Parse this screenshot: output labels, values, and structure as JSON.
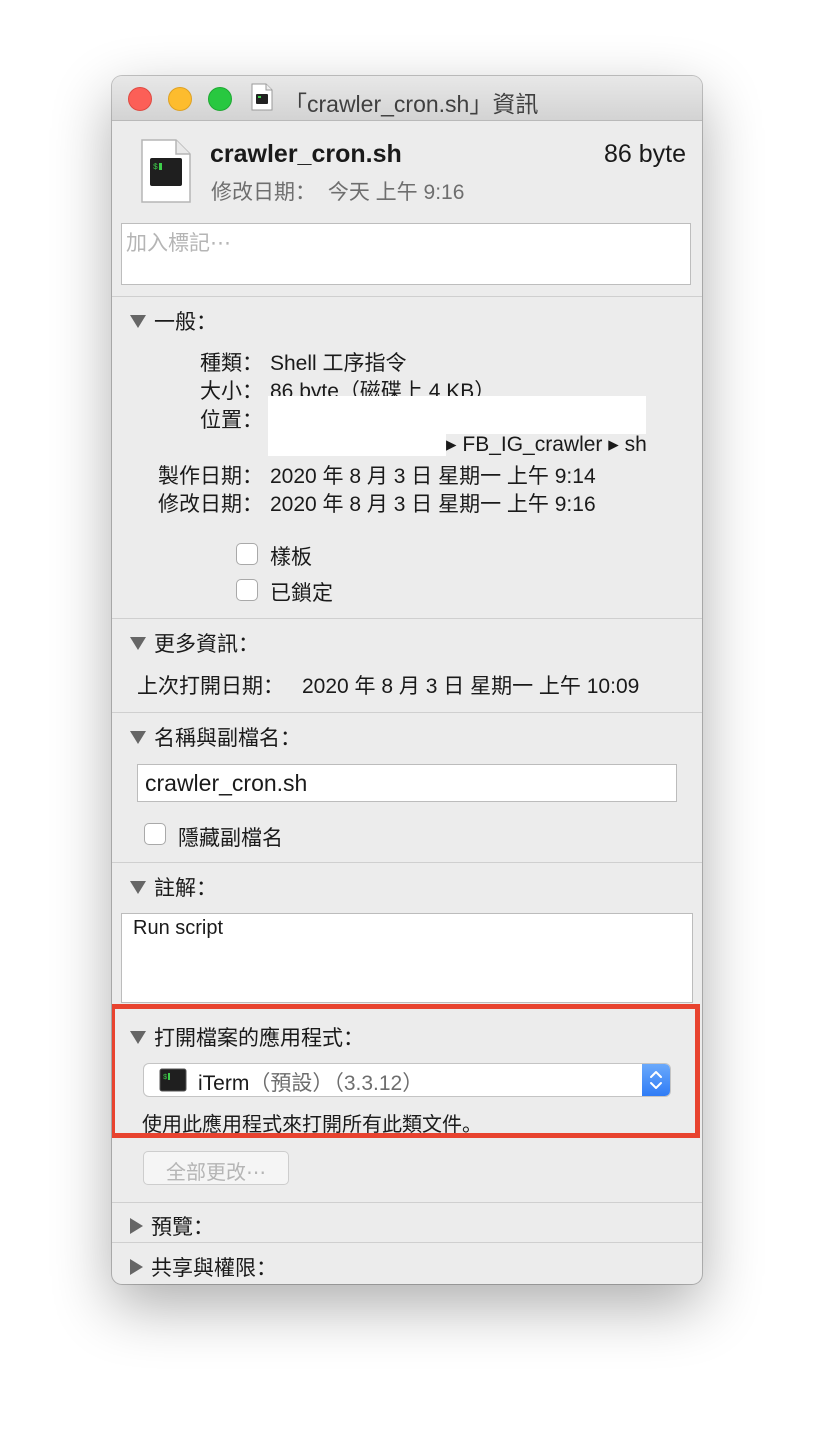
{
  "window": {
    "title": "「crawler_cron.sh」資訊"
  },
  "file": {
    "name": "crawler_cron.sh",
    "size": "86 byte",
    "modified_label": "修改日期：",
    "modified_value": "今天 上午 9:16"
  },
  "tags": {
    "placeholder": "加入標記⋯"
  },
  "general": {
    "heading": "一般：",
    "kind_label": "種類：",
    "kind_value": "Shell 工序指令",
    "size_label": "大小：",
    "size_value": "86 byte（磁碟上 4 KB）",
    "where_label": "位置：",
    "where_value": "▸ FB_IG_crawler ▸ sh",
    "created_label": "製作日期：",
    "created_value": "2020 年 8 月 3 日 星期一 上午 9:14",
    "modified_label": "修改日期：",
    "modified_value": "2020 年 8 月 3 日 星期一 上午 9:16",
    "stationery_label": "樣板",
    "locked_label": "已鎖定"
  },
  "more_info": {
    "heading": "更多資訊：",
    "last_opened_label": "上次打開日期：",
    "last_opened_value": "2020 年 8 月 3 日 星期一 上午 10:09"
  },
  "name_ext": {
    "heading": "名稱與副檔名：",
    "field_value": "crawler_cron.sh",
    "hide_ext_label": "隱藏副檔名"
  },
  "comments": {
    "heading": "註解：",
    "value": "Run script"
  },
  "open_with": {
    "heading": "打開檔案的應用程式：",
    "app_name": "iTerm",
    "app_default": "（預設）",
    "app_version": "（3.3.12）",
    "helper_text": "使用此應用程式來打開所有此類文件。",
    "change_all_label": "全部更改⋯"
  },
  "preview": {
    "heading": "預覽："
  },
  "sharing": {
    "heading": "共享與權限："
  },
  "colors": {
    "highlight": "#e8432f",
    "accent": "#2f7cf6"
  }
}
